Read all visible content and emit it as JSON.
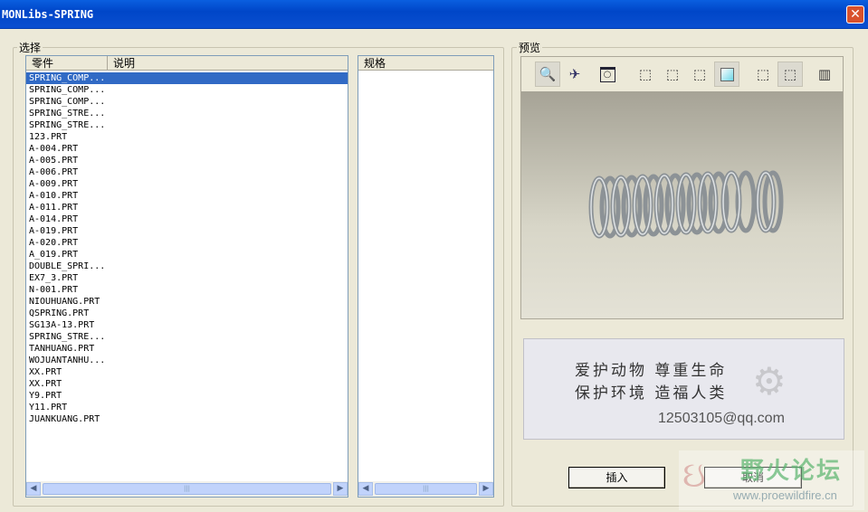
{
  "window": {
    "title": "MONLibs-SPRING",
    "close": "✕"
  },
  "select_group": {
    "label": "选择",
    "columns": [
      "零件",
      "说明"
    ],
    "items": [
      "SPRING_COMP...",
      "SPRING_COMP...",
      "SPRING_COMP...",
      "SPRING_STRE...",
      "SPRING_STRE...",
      "123.PRT",
      "A-004.PRT",
      "A-005.PRT",
      "A-006.PRT",
      "A-009.PRT",
      "A-010.PRT",
      "A-011.PRT",
      "A-014.PRT",
      "A-019.PRT",
      "A-020.PRT",
      "A_019.PRT",
      "DOUBLE_SPRI...",
      "EX7_3.PRT",
      "N-001.PRT",
      "NIOUHUANG.PRT",
      "QSPRING.PRT",
      "SG13A-13.PRT",
      "SPRING_STRE...",
      "TANHUANG.PRT",
      "WOJUANTANHU...",
      "XX.PRT",
      "XX.PRT",
      "Y9.PRT",
      "Y11.PRT",
      "JUANKUANG.PRT"
    ],
    "selected_index": 0,
    "spec_column": "规格"
  },
  "preview_group": {
    "label": "预览",
    "toolbar": [
      "spin-icon",
      "fly-icon",
      "zoom-window-icon",
      "wireframe-icon",
      "hidden-line-icon",
      "no-hidden-icon",
      "shaded-icon",
      "perspective-icon",
      "orthographic-icon",
      "animation-icon"
    ]
  },
  "banner": {
    "line1": "爱护动物  尊重生命",
    "line2": "保护环境  造福人类",
    "email": "12503105@qq.com"
  },
  "buttons": {
    "insert": "插入",
    "cancel": "取消"
  },
  "watermark": {
    "name": "野火论坛",
    "url": "www.proewildfire.cn"
  }
}
